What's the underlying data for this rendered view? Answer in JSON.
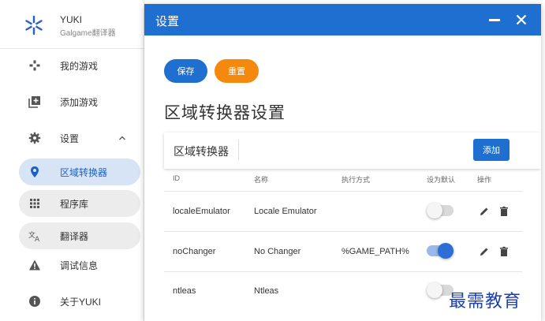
{
  "brand": {
    "title": "YUKI",
    "subtitle": "Galgame翻译器"
  },
  "sidebar": {
    "items": [
      {
        "label": "我的游戏",
        "icon": "gamepad-icon"
      },
      {
        "label": "添加游戏",
        "icon": "add-library-icon"
      },
      {
        "label": "设置",
        "icon": "gear-icon"
      },
      {
        "label": "区域转换器",
        "icon": "location-pin-icon"
      },
      {
        "label": "程序库",
        "icon": "grid-icon"
      },
      {
        "label": "翻译器",
        "icon": "translate-icon"
      },
      {
        "label": "调试信息",
        "icon": "warning-icon"
      },
      {
        "label": "关于YUKI",
        "icon": "info-icon"
      }
    ]
  },
  "dialog": {
    "title": "设置",
    "save_label": "保存",
    "reset_label": "重置",
    "section_title": "区域转换器设置",
    "card_title": "区域转换器",
    "add_label": "添加"
  },
  "table": {
    "headers": [
      "ID",
      "名称",
      "执行方式",
      "设为默认",
      "操作"
    ],
    "rows": [
      {
        "id": "localeEmulator",
        "name": "Locale Emulator",
        "exec": "",
        "default": false
      },
      {
        "id": "noChanger",
        "name": "No Changer",
        "exec": "%GAME_PATH%",
        "default": true
      },
      {
        "id": "ntleas",
        "name": "Ntleas",
        "exec": "",
        "default": false
      }
    ]
  },
  "watermark": "最需教育",
  "colors": {
    "primary": "#1f6fd1",
    "reset": "#f5890d",
    "active_bg": "#d6e4f5"
  }
}
